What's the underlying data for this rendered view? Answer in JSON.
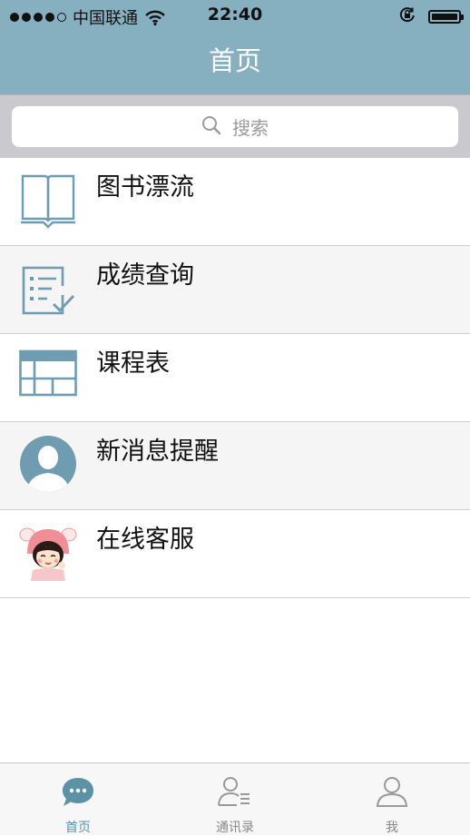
{
  "status_bar": {
    "carrier": "中国联通",
    "time": "22:40",
    "signal_bars": 4,
    "battery_level": 1.0
  },
  "nav": {
    "title": "首页"
  },
  "search": {
    "placeholder": "搜索"
  },
  "list": {
    "items": [
      {
        "label": "图书漂流",
        "icon": "book-icon"
      },
      {
        "label": "成绩查询",
        "icon": "checklist-icon"
      },
      {
        "label": "课程表",
        "icon": "table-icon"
      },
      {
        "label": "新消息提醒",
        "icon": "avatar-icon"
      },
      {
        "label": "在线客服",
        "icon": "cartoon-girl-icon"
      }
    ]
  },
  "tabbar": {
    "tabs": [
      {
        "label": "首页",
        "icon": "chat-bubble-icon",
        "active": true
      },
      {
        "label": "通讯录",
        "icon": "contacts-icon",
        "active": false
      },
      {
        "label": "我",
        "icon": "person-icon",
        "active": false
      }
    ]
  },
  "colors": {
    "header": "#86afbf",
    "accent": "#5d91a6",
    "icon": "#6f9cb0"
  }
}
